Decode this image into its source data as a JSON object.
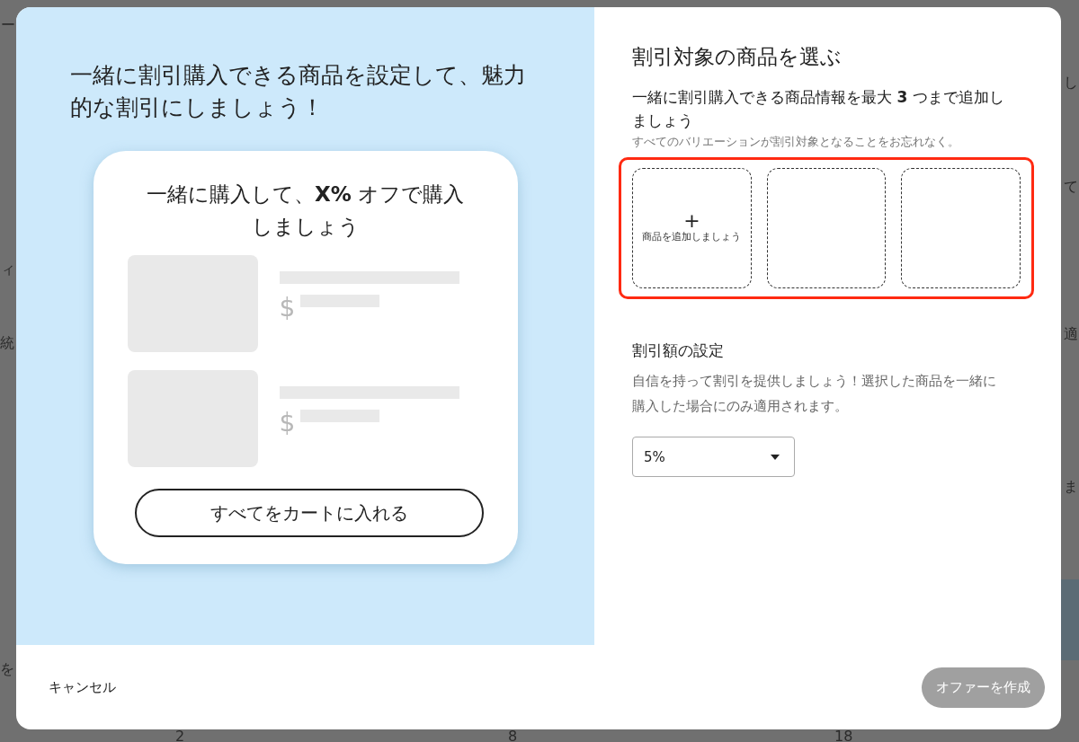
{
  "background_fragments": [
    {
      "text": "ー"
    },
    {
      "text": "ィ"
    },
    {
      "text": "統"
    },
    {
      "text": "を"
    },
    {
      "text": "し"
    },
    {
      "text": "て"
    },
    {
      "text": "適"
    },
    {
      "text": "ま"
    },
    {
      "text": "2"
    },
    {
      "text": "8"
    },
    {
      "text": "18"
    }
  ],
  "preview_panel": {
    "headline": "一緒に割引購入できる商品を設定して、魅力的な割引にしましょう！",
    "card": {
      "title": "一緒に購入して、**X%** オフで購入しましょう",
      "products": [
        {
          "currency": "$"
        },
        {
          "currency": "$"
        }
      ],
      "button": "すべてをカートに入れる"
    }
  },
  "product_section": {
    "title": "割引対象の商品を選ぶ",
    "description": "一緒に割引購入できる商品情報を最大 **3** つまで追加しましょう",
    "note": "すべてのバリエーションが割引対象となることをお忘れなく。",
    "highlighted": true,
    "slots": [
      {
        "kind": "add",
        "label": "商品を追加しましょう",
        "icon": "+"
      },
      {
        "kind": "empty"
      },
      {
        "kind": "empty"
      }
    ]
  },
  "discount_section": {
    "title": "割引額の設定",
    "description": "自信を持って割引を提供しましょう！選択した商品を一緒に購入した場合にのみ適用されます。",
    "select": {
      "value": "5%"
    }
  },
  "footer": {
    "cancel": "キャンセル",
    "create": {
      "label": "オファーを作成",
      "disabled": true
    }
  }
}
